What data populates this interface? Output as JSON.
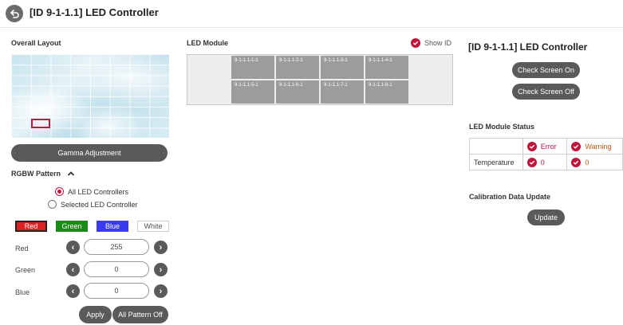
{
  "header": {
    "title": "[ID 9-1-1.1] LED Controller"
  },
  "overall_layout": {
    "title": "Overall Layout"
  },
  "gamma": {
    "label": "Gamma Adjustment"
  },
  "rgbw": {
    "title": "RGBW Pattern",
    "radio_all": "All LED Controllers",
    "radio_selected": "Selected LED Controller",
    "colors": {
      "red": "Red",
      "green": "Green",
      "blue": "Blue",
      "white": "White"
    },
    "red_label": "Red",
    "red_value": "255",
    "green_label": "Green",
    "green_value": "0",
    "blue_label": "Blue",
    "blue_value": "0",
    "apply": "Apply",
    "all_off": "All Pattern Off"
  },
  "led_module": {
    "title": "LED Module",
    "show_id": "Show ID",
    "cells": [
      "9-1-1.1-1-1",
      "9-1-1.1-2-1",
      "9-1-1.1-3-1",
      "9-1-1.1-4-1",
      "9-1-1.1-5-1",
      "9-1-1.1-6-1",
      "9-1-1.1-7-1",
      "9-1-1.1-8-1"
    ]
  },
  "right": {
    "title": "[ID 9-1-1.1] LED Controller",
    "screen_on": "Check Screen On",
    "screen_off": "Check Screen Off",
    "status_title": "LED Module Status",
    "error": "Error",
    "warning": "Warning",
    "row_label": "Temperature",
    "error_count": "0",
    "warning_count": "0",
    "calibration_title": "Calibration Data Update",
    "update": "Update"
  },
  "colors": {
    "accent": "#c0143c",
    "button": "#5a5a5a"
  }
}
